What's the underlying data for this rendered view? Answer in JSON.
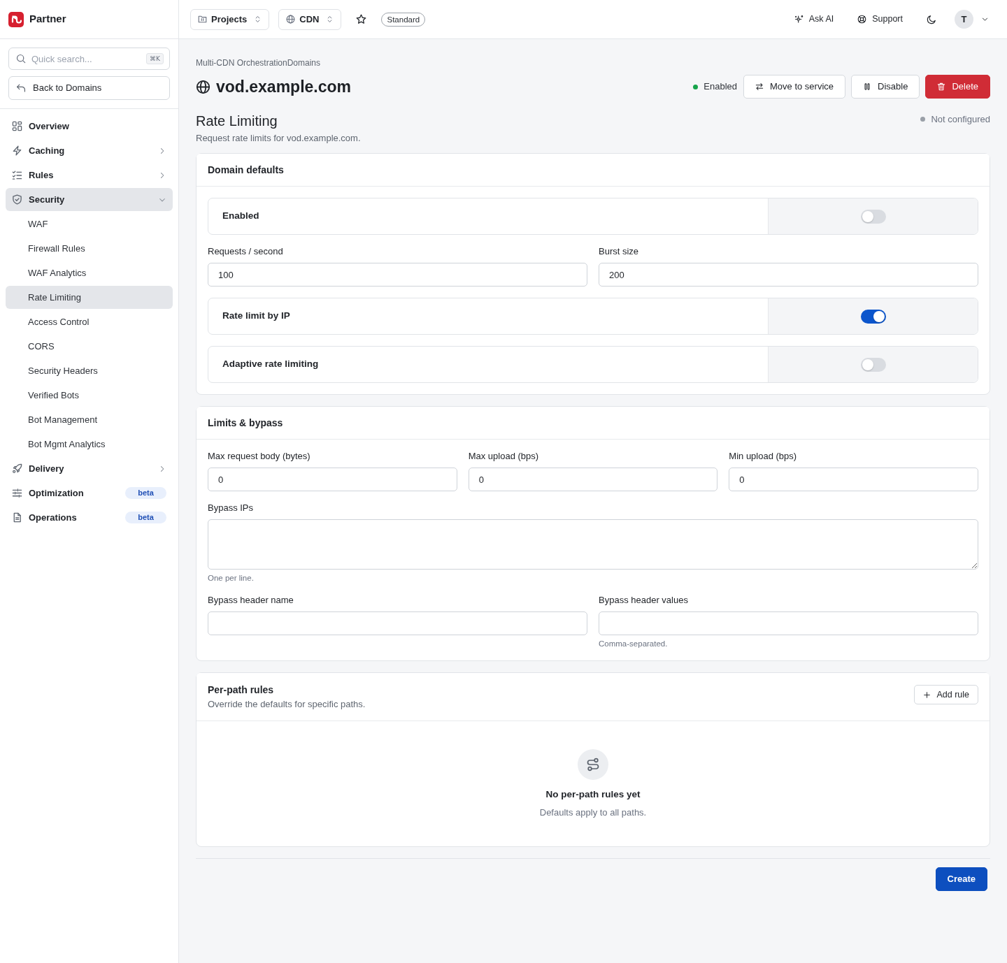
{
  "sidebar": {
    "brand": "Partner",
    "search": {
      "placeholder": "Quick search...",
      "shortcut": "⌘K"
    },
    "back_button": "Back to Domains",
    "items": [
      {
        "label": "Overview",
        "kind": "link",
        "selected": false
      },
      {
        "label": "Caching",
        "kind": "group",
        "expanded": false,
        "selected": false
      },
      {
        "label": "Rules",
        "kind": "group",
        "expanded": false,
        "selected": false
      },
      {
        "label": "Security",
        "kind": "group",
        "expanded": true,
        "selected": true,
        "children": [
          {
            "label": "WAF",
            "selected": false
          },
          {
            "label": "Firewall Rules",
            "selected": false
          },
          {
            "label": "WAF Analytics",
            "selected": false
          },
          {
            "label": "Rate Limiting",
            "selected": true
          },
          {
            "label": "Access Control",
            "selected": false
          },
          {
            "label": "CORS",
            "selected": false
          },
          {
            "label": "Security Headers",
            "selected": false
          },
          {
            "label": "Verified Bots",
            "selected": false
          },
          {
            "label": "Bot Management",
            "selected": false
          },
          {
            "label": "Bot Mgmt Analytics",
            "selected": false
          }
        ]
      },
      {
        "label": "Delivery",
        "kind": "group",
        "expanded": false,
        "selected": false
      },
      {
        "label": "Optimization",
        "kind": "link",
        "selected": false,
        "badge": "beta"
      },
      {
        "label": "Operations",
        "kind": "link",
        "selected": false,
        "badge": "beta"
      }
    ]
  },
  "top_bar": {
    "switchers": [
      {
        "label": "Projects"
      },
      {
        "label": "CDN"
      }
    ],
    "starred": false,
    "plan": "Standard",
    "actions": [
      {
        "label": "Ask AI"
      },
      {
        "label": "Support"
      }
    ],
    "avatar": "T"
  },
  "header": {
    "breadcrumb": "Multi-CDN OrchestrationDomains",
    "title": "vod.example.com",
    "status": {
      "label": "Enabled",
      "kind": "ok"
    },
    "buttons": [
      {
        "label": "Move to service",
        "kind": "outline"
      },
      {
        "label": "Disable",
        "kind": "outline"
      },
      {
        "label": "Delete",
        "kind": "danger"
      }
    ]
  },
  "section": {
    "title": "Rate Limiting",
    "subtitle": "Request rate limits for vod.example.com.",
    "status": {
      "label": "Not configured",
      "kind": "neutral"
    }
  },
  "cards": [
    {
      "title": "Domain defaults",
      "rows": [
        {
          "kind": "toggle",
          "label": "Enabled",
          "on": false
        },
        {
          "kind": "fields",
          "fields": [
            {
              "label": "Requests / second",
              "value": "100"
            },
            {
              "label": "Burst size",
              "value": "200"
            }
          ]
        },
        {
          "kind": "toggle",
          "label": "Rate limit by IP",
          "on": true
        },
        {
          "kind": "toggle",
          "label": "Adaptive rate limiting",
          "on": false
        }
      ]
    },
    {
      "title": "Limits & bypass",
      "rows": [
        {
          "kind": "fields",
          "fields": [
            {
              "label": "Max request body (bytes)",
              "value": "0"
            },
            {
              "label": "Max upload (bps)",
              "value": "0"
            },
            {
              "label": "Min upload (bps)",
              "value": "0"
            }
          ]
        },
        {
          "kind": "textarea",
          "label": "Bypass IPs",
          "hint": "One per line."
        },
        {
          "kind": "fields",
          "fields": [
            {
              "label": "Bypass header name"
            },
            {
              "label": "Bypass header values",
              "hint": "Comma-separated."
            }
          ]
        }
      ]
    },
    {
      "title": "Per-path rules",
      "subtitle": "Override the defaults for specific paths.",
      "action": "Add rule",
      "empty": {
        "title": "No per-path rules yet",
        "text": "Defaults apply to all paths."
      }
    }
  ],
  "footer": {
    "submit": "Create"
  }
}
